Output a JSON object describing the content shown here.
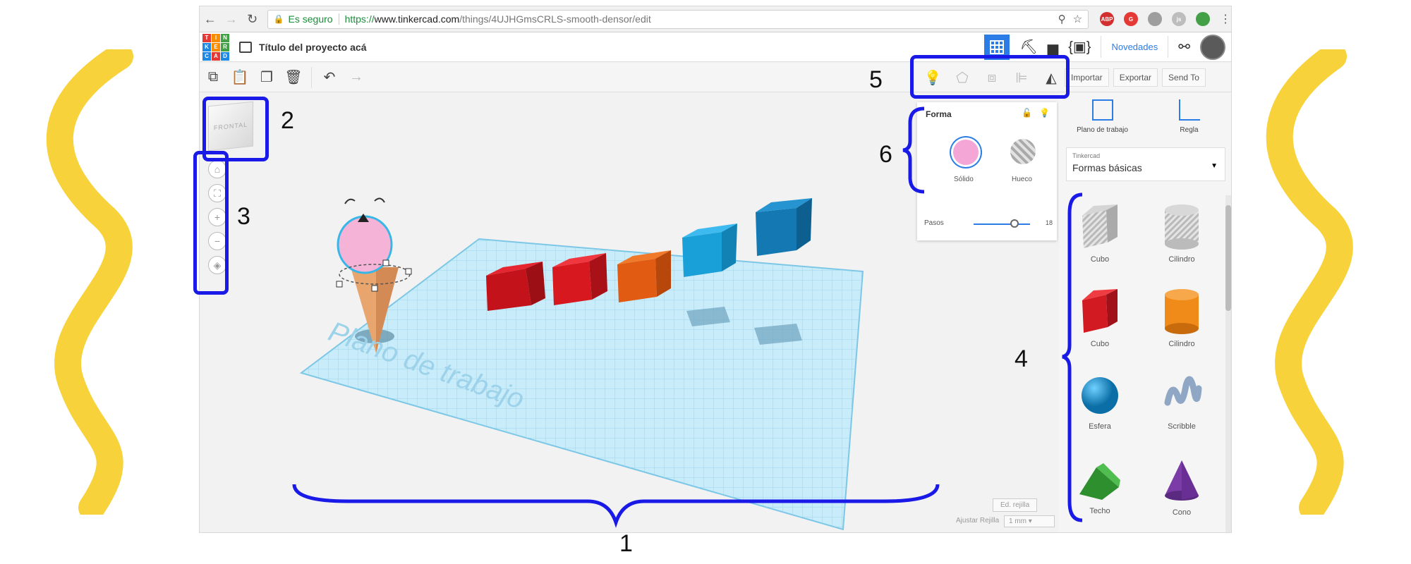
{
  "browser": {
    "secure_label": "Es seguro",
    "url_https": "https://",
    "url_host": "www.tinkercad.com",
    "url_path": "/things/4UJHGmsCRLS-smooth-densor/edit"
  },
  "header": {
    "logo_letters": [
      "T",
      "I",
      "N",
      "K",
      "E",
      "R",
      "C",
      "A",
      "D"
    ],
    "project_title": "Título del proyecto acá",
    "novedades": "Novedades"
  },
  "actions": {
    "import": "Importar",
    "export": "Exportar",
    "send_to": "Send To"
  },
  "inspector": {
    "title": "Forma",
    "solid_label": "Sólido",
    "hole_label": "Hueco",
    "steps_label": "Pasos",
    "steps_value": "18",
    "solid_color": "#f4a6d7"
  },
  "workspace": {
    "view_cube_label": "FRONTAL",
    "workplane_label": "Plano de trabajo",
    "edit_grid": "Ed. rejilla",
    "snap_grid_label": "Ajustar Rejilla",
    "snap_grid_value": "1 mm"
  },
  "library": {
    "workplane_tool": "Plano de trabajo",
    "ruler_tool": "Regla",
    "category_sub": "Tinkercad",
    "category_main": "Formas básicas",
    "shapes": [
      {
        "name": "Cubo"
      },
      {
        "name": "Cilindro"
      },
      {
        "name": "Cubo"
      },
      {
        "name": "Cilindro"
      },
      {
        "name": "Esfera"
      },
      {
        "name": "Scribble"
      },
      {
        "name": "Techo"
      },
      {
        "name": "Cono"
      }
    ]
  },
  "annotations": [
    "1",
    "2",
    "3",
    "4",
    "5",
    "6"
  ],
  "colors": {
    "accent": "#2c7ce5",
    "annotation": "#1a1ae8",
    "squiggle": "#f7d23a"
  }
}
